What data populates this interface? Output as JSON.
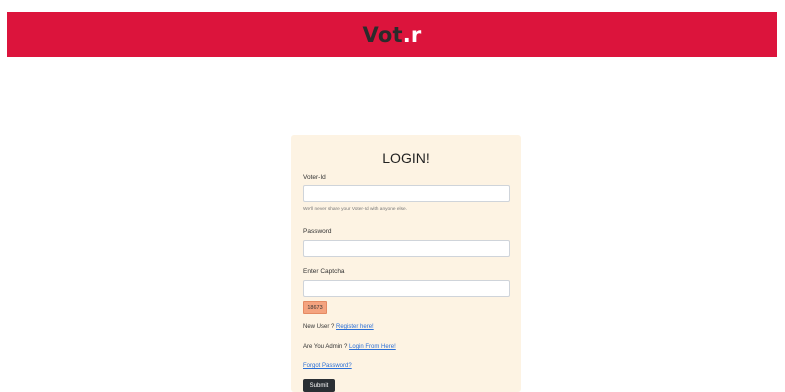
{
  "header": {
    "brand_main": "Vot",
    "brand_accent": ".r"
  },
  "login": {
    "title": "LOGIN!",
    "voter_id_label": "Voter-Id",
    "voter_id_value": "",
    "voter_id_help": "We'll never share your Voter-Id with anyone else.",
    "password_label": "Password",
    "password_value": "",
    "captcha_label": "Enter Captcha",
    "captcha_value": "",
    "captcha_code": "18673",
    "new_user_text": "New User ?",
    "register_link": "Register here!",
    "admin_text": "Are You Admin ?",
    "admin_link": "Login From Here!",
    "forgot_link": "Forgot Password?",
    "submit_label": "Submit"
  },
  "colors": {
    "header_bg": "#dc143c",
    "card_bg": "#fdf3e3",
    "captcha_bg": "#f4a37f",
    "button_bg": "#2a2f34",
    "link": "#2b6fd6"
  }
}
